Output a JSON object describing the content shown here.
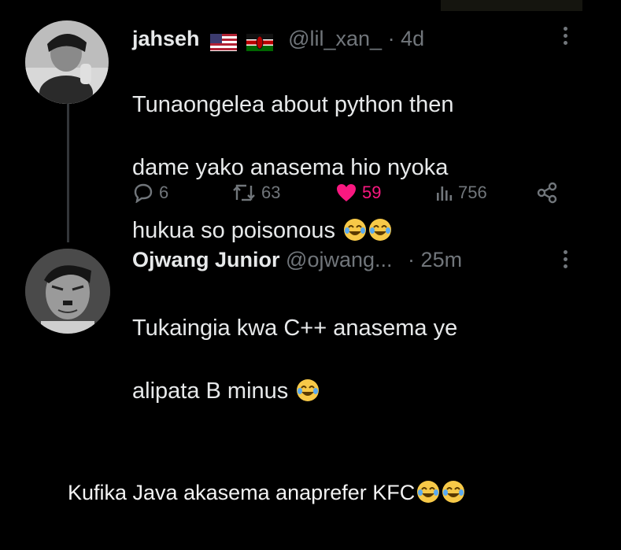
{
  "tweets": [
    {
      "name": "jahseh",
      "flags": [
        "us-flag",
        "kenya-flag"
      ],
      "handle": "@lil_xan_",
      "sep": "·",
      "time": "4d",
      "lines": [
        "Tunaongelea about python then",
        "dame yako anasema hio nyoka",
        "hukua so poisonous"
      ],
      "trailing_emoji": [
        "joy-emoji",
        "joy-emoji"
      ],
      "stats": {
        "replies": "6",
        "retweets": "63",
        "likes": "59",
        "views": "756"
      }
    },
    {
      "name": "Ojwang Junior",
      "handle": "@ojwang...",
      "sep": "·",
      "time": "25m",
      "lines": [
        "Tukaingia kwa C++ anasema ye",
        "alipata B minus"
      ],
      "trailing_emoji": [
        "joy-emoji"
      ]
    }
  ],
  "caption": {
    "text": "Kufika Java akasema anaprefer KFC",
    "trailing_emoji": [
      "joy-emoji",
      "joy-emoji"
    ]
  },
  "colors": {
    "background": "#000000",
    "text": "#e7e9ea",
    "muted": "#71767b",
    "like": "#f91880",
    "thread_line": "#333639"
  }
}
